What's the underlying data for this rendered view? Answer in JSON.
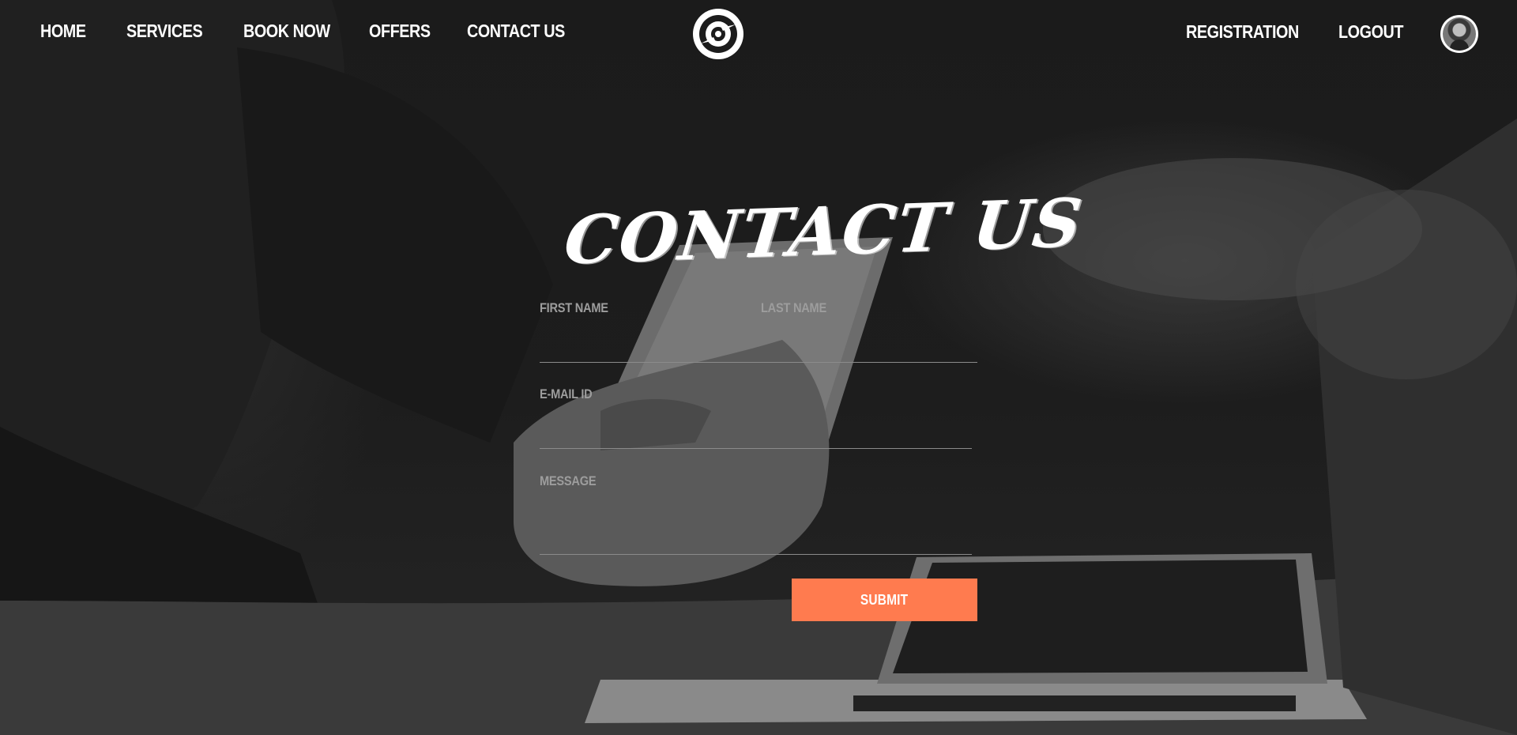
{
  "nav": {
    "left_links": [
      {
        "label": "HOME"
      },
      {
        "label": "SERVICES"
      },
      {
        "label": "BOOK NOW"
      },
      {
        "label": "OFFERS"
      },
      {
        "label": "CONTACT US"
      }
    ],
    "right_links": [
      {
        "label": "REGISTRATION"
      },
      {
        "label": "LOGOUT"
      }
    ],
    "logo_icon": "target-logo-icon",
    "avatar_icon": "user-avatar"
  },
  "page": {
    "heading": "CONTACT US"
  },
  "form": {
    "first_name_label": "FIRST NAME",
    "last_name_label": "LAST NAME",
    "email_label": "E-MAIL ID",
    "message_label": "MESSAGE",
    "first_name_value": "",
    "last_name_value": "",
    "email_value": "",
    "message_value": "",
    "submit_label": "SUBMIT"
  },
  "colors": {
    "accent": "#ff7b4f",
    "background": "#1c1c1c",
    "label": "#9d9d9d",
    "text": "#ffffff"
  }
}
